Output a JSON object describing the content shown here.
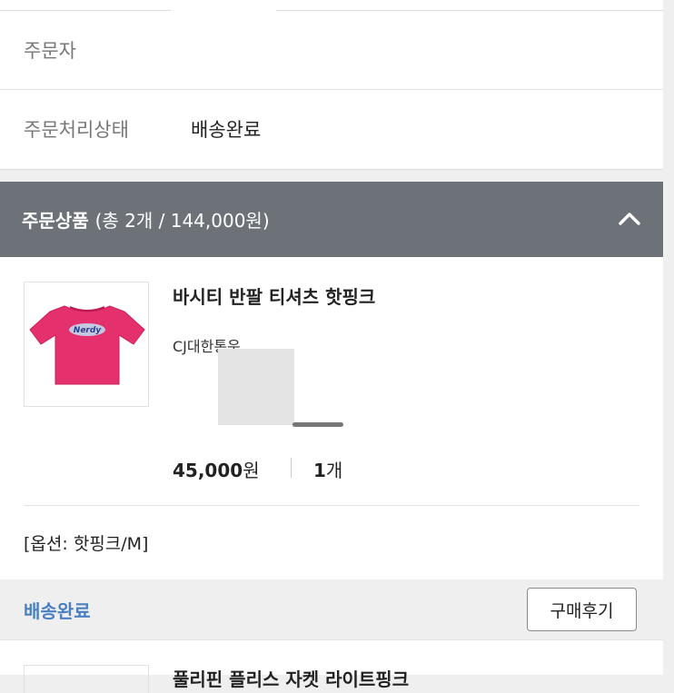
{
  "order_info": {
    "rows": [
      {
        "label": "주문자",
        "value": ""
      },
      {
        "label": "주문처리상태",
        "value": "배송완료"
      }
    ]
  },
  "section": {
    "title": "주문상품",
    "summary": "(총 2개 / 144,000원)",
    "toggle_icon": "chevron-up-icon"
  },
  "products": [
    {
      "name": "바시티 반팔 티셔츠 핫핑크",
      "seller": "CJ대한통운",
      "price": "45,000",
      "price_unit": "원",
      "quantity": "1",
      "quantity_unit": "개",
      "option": "[옵션: 핫핑크/M]",
      "status": "배송완료",
      "review_button": "구매후기",
      "thumbnail": {
        "shirt_color": "#e5306e",
        "logo_text": "Nerdy"
      }
    },
    {
      "name": "풀리핀 플리스 자켓 라이트핑크"
    }
  ],
  "colors": {
    "header_bg": "#6c7278",
    "status_blue": "#4a7fc1",
    "page_bg": "#efefef"
  }
}
